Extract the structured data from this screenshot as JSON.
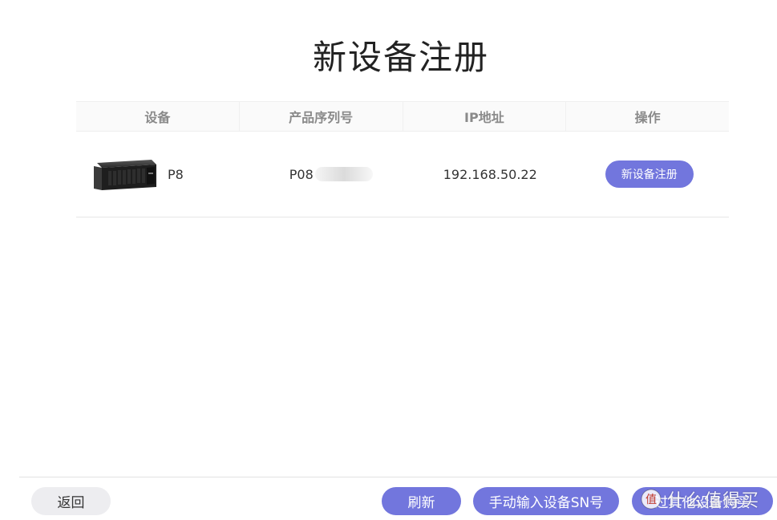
{
  "page": {
    "title": "新设备注册"
  },
  "table": {
    "headers": {
      "device": "设备",
      "serial": "产品序列号",
      "ip": "IP地址",
      "action": "操作"
    },
    "rows": [
      {
        "device_name": "P8",
        "serial_visible": "P08",
        "ip": "192.168.50.22",
        "action_label": "新设备注册"
      }
    ]
  },
  "footer": {
    "back_label": "返回",
    "refresh_label": "刷新",
    "manual_sn_label": "手动输入设备SN号",
    "other_label": "过其他设备购买"
  },
  "watermark": {
    "text": "什么值得买"
  },
  "colors": {
    "accent": "#7276dd",
    "secondary_button": "#ededf0",
    "header_text": "#8a8a8a"
  }
}
